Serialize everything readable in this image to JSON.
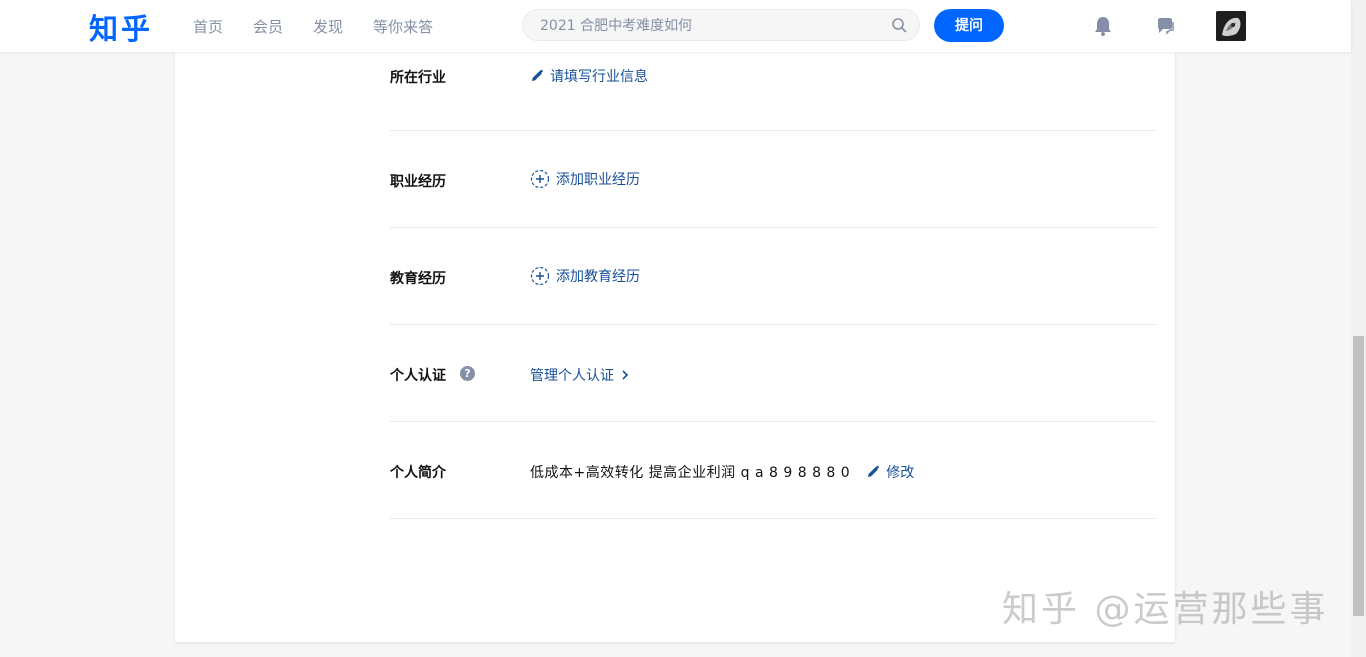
{
  "header": {
    "logo": "知乎",
    "nav": [
      "首页",
      "会员",
      "发现",
      "等你来答"
    ],
    "search_placeholder": "2021 合肥中考难度如何",
    "ask_label": "提问"
  },
  "profile": {
    "industry": {
      "label": "所在行业",
      "action": "请填写行业信息"
    },
    "career": {
      "label": "职业经历",
      "action": "添加职业经历"
    },
    "education": {
      "label": "教育经历",
      "action": "添加教育经历"
    },
    "verification": {
      "label": "个人认证",
      "help": "?",
      "action": "管理个人认证"
    },
    "bio": {
      "label": "个人简介",
      "text": "低成本+高效转化 提高企业利润 q a 8 9 8 8 8 0",
      "edit": "修改"
    }
  },
  "watermark": "知乎 @运营那些事",
  "icons": {
    "search": "search-icon",
    "bell": "bell-icon",
    "message": "chat-icon",
    "pencil": "pencil-icon",
    "add": "add-circle-icon",
    "chevron": "chevron-right-icon"
  },
  "colors": {
    "brand": "#0066ff",
    "link": "#175199",
    "muted": "#8590a6"
  }
}
